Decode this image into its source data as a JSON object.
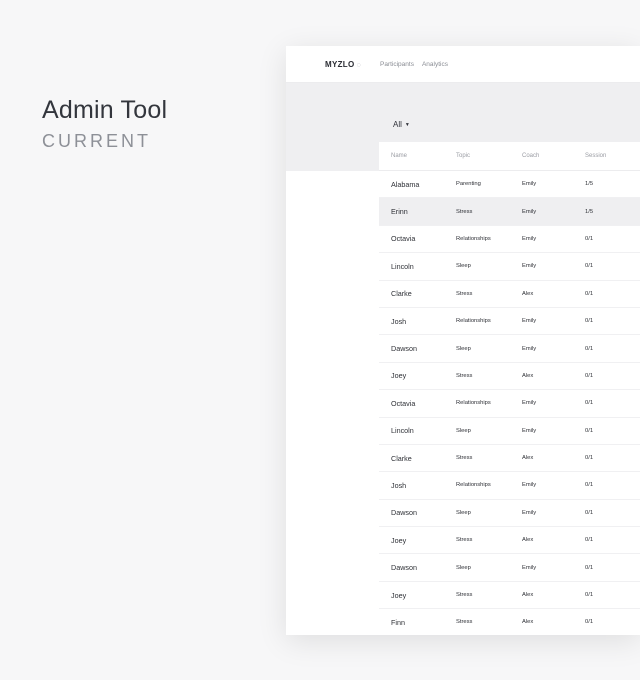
{
  "headline": {
    "title": "Admin Tool",
    "subtitle": "CURRENT"
  },
  "app": {
    "logo": "MYZLO",
    "logo_mark": "◌",
    "nav": [
      "Participants",
      "Analytics"
    ],
    "filter": {
      "value": "All",
      "caret": "▼"
    },
    "table": {
      "columns": [
        "Name",
        "Topic",
        "Coach",
        "Session"
      ],
      "rows": [
        {
          "name": "Alabama",
          "topic": "Parenting",
          "coach": "Emily",
          "session": "1/5"
        },
        {
          "name": "Erinn",
          "topic": "Stress",
          "coach": "Emily",
          "session": "1/5"
        },
        {
          "name": "Octavia",
          "topic": "Relationships",
          "coach": "Emily",
          "session": "0/1"
        },
        {
          "name": "Lincoln",
          "topic": "Sleep",
          "coach": "Emily",
          "session": "0/1"
        },
        {
          "name": "Clarke",
          "topic": "Stress",
          "coach": "Alex",
          "session": "0/1"
        },
        {
          "name": "Josh",
          "topic": "Relationships",
          "coach": "Emily",
          "session": "0/1"
        },
        {
          "name": "Dawson",
          "topic": "Sleep",
          "coach": "Emily",
          "session": "0/1"
        },
        {
          "name": "Joey",
          "topic": "Stress",
          "coach": "Alex",
          "session": "0/1"
        },
        {
          "name": "Octavia",
          "topic": "Relationships",
          "coach": "Emily",
          "session": "0/1"
        },
        {
          "name": "Lincoln",
          "topic": "Sleep",
          "coach": "Emily",
          "session": "0/1"
        },
        {
          "name": "Clarke",
          "topic": "Stress",
          "coach": "Alex",
          "session": "0/1"
        },
        {
          "name": "Josh",
          "topic": "Relationships",
          "coach": "Emily",
          "session": "0/1"
        },
        {
          "name": "Dawson",
          "topic": "Sleep",
          "coach": "Emily",
          "session": "0/1"
        },
        {
          "name": "Joey",
          "topic": "Stress",
          "coach": "Alex",
          "session": "0/1"
        },
        {
          "name": "Dawson",
          "topic": "Sleep",
          "coach": "Emily",
          "session": "0/1"
        },
        {
          "name": "Joey",
          "topic": "Stress",
          "coach": "Alex",
          "session": "0/1"
        },
        {
          "name": "Finn",
          "topic": "Stress",
          "coach": "Alex",
          "session": "0/1"
        }
      ],
      "selected_row": 1
    }
  }
}
